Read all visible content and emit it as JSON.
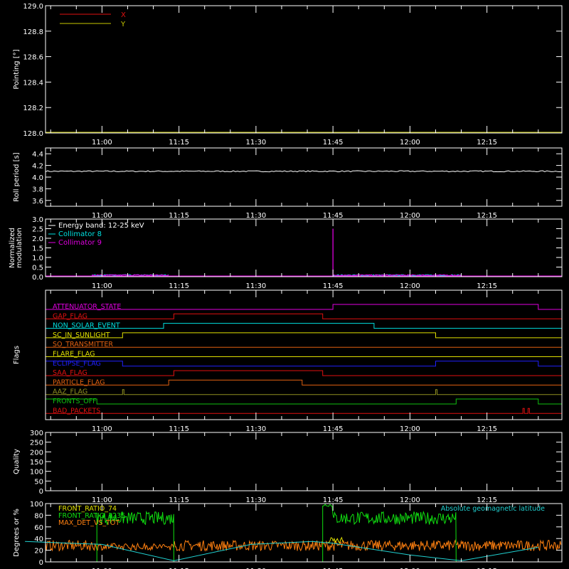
{
  "time_ticks": [
    "11:00",
    "11:15",
    "11:30",
    "11:45",
    "12:00",
    "12:15"
  ],
  "chart_data": [
    {
      "type": "line",
      "ylabel": "Pointing [°]",
      "ylim": [
        128.0,
        129.0
      ],
      "yticks": [
        "128.0",
        "128.2",
        "128.4",
        "128.6",
        "128.8",
        "129.0"
      ],
      "legend_position": "top-left",
      "series": [
        {
          "name": "X",
          "color": "#e01010",
          "values": []
        },
        {
          "name": "Y",
          "color": "#c8c800",
          "values": []
        }
      ]
    },
    {
      "type": "line",
      "ylabel": "Roll period [s]",
      "ylim": [
        3.5,
        4.5
      ],
      "yticks": [
        "3.6",
        "3.8",
        "4.0",
        "4.2",
        "4.4"
      ],
      "series": [
        {
          "color": "#ffffff",
          "x": [
            "10:45",
            "12:25"
          ],
          "values": [
            4.1,
            4.1
          ]
        }
      ]
    },
    {
      "type": "line",
      "ylabel": [
        "Normalized",
        "modulation"
      ],
      "ylim": [
        0,
        3.0
      ],
      "yticks": [
        "0.0",
        "0.5",
        "1.0",
        "1.5",
        "2.0",
        "2.5",
        "3.0"
      ],
      "legend_position": "top-left",
      "legend_title": "Energy band: 12-25 keV",
      "series": [
        {
          "name": "Collimator 8",
          "color": "#00e0e0",
          "segments": [
            [
              "10:58",
              "11:13"
            ],
            [
              "11:45",
              "12:10"
            ]
          ],
          "baseline": 0.05,
          "spike": null
        },
        {
          "name": "Collimator 9",
          "color": "#e000e0",
          "segments": [
            [
              "10:58",
              "11:13"
            ],
            [
              "11:45",
              "12:10"
            ]
          ],
          "baseline": 0.05,
          "spike": {
            "x": "11:45",
            "value": 2.5
          }
        }
      ]
    },
    {
      "type": "step",
      "ylabel": "Flags",
      "flags": [
        {
          "name": "ATTENUATOR_STATE",
          "color": "#e000e0",
          "on": [
            [
              "11:45",
              "12:25"
            ]
          ]
        },
        {
          "name": "GAP_FLAG",
          "color": "#e01010",
          "on": [
            [
              "11:14",
              "11:43"
            ]
          ]
        },
        {
          "name": "NON_SOLAR_EVENT",
          "color": "#00e0e0",
          "on": [
            [
              "11:12",
              "11:53"
            ]
          ]
        },
        {
          "name": "SC_IN_SUNLIGHT",
          "color": "#e0e000",
          "on": [
            [
              "11:04",
              "12:05"
            ]
          ]
        },
        {
          "name": "SO_TRANSMITTER",
          "color": "#e06010",
          "on": []
        },
        {
          "name": "FLARE_FLAG",
          "color": "#e0e000",
          "on": []
        },
        {
          "name": "ECLIPSE_FLAG",
          "color": "#2020ff",
          "on": [
            [
              "10:45",
              "11:04"
            ],
            [
              "12:05",
              "12:25"
            ]
          ]
        },
        {
          "name": "SAA_FLAG",
          "color": "#e01010",
          "on": [
            [
              "11:14",
              "11:43"
            ]
          ]
        },
        {
          "name": "PARTICLE_FLAG",
          "color": "#e06010",
          "on": [
            [
              "11:13",
              "11:39"
            ]
          ]
        },
        {
          "name": "AAZ_FLAG",
          "color": "#909020",
          "on": [
            [
              "11:04",
              "11:04"
            ],
            [
              "12:05",
              "12:05"
            ]
          ]
        },
        {
          "name": "FRONTS_OFF",
          "color": "#10c010",
          "on": [
            [
              "10:45",
              "10:59"
            ],
            [
              "12:09",
              "12:25"
            ]
          ]
        },
        {
          "name": "BAD_PACKETS",
          "color": "#e01010",
          "on": [
            [
              "12:22",
              "12:22"
            ],
            [
              "12:23",
              "12:23"
            ]
          ]
        }
      ]
    },
    {
      "type": "line",
      "ylabel": "Quality",
      "ylim": [
        0,
        300
      ],
      "yticks": [
        "0",
        "50",
        "100",
        "150",
        "200",
        "250",
        "300"
      ],
      "series": [
        {
          "color": "#ffffff",
          "x": [
            "10:45",
            "12:25"
          ],
          "values": [
            300,
            300
          ]
        }
      ]
    },
    {
      "type": "line",
      "ylabel": "Degrees or %",
      "ylim": [
        0,
        100
      ],
      "yticks": [
        "0",
        "20",
        "40",
        "60",
        "80",
        "100"
      ],
      "legend_position": "top-left",
      "series": [
        {
          "name": "FRONT_RATIO_74",
          "color": "#e0e000"
        },
        {
          "name": "FRONT_RATIO_1235",
          "color": "#10e010",
          "segments": [
            [
              "10:59",
              "11:14"
            ],
            [
              "11:43",
              "12:09"
            ]
          ],
          "level": 75
        },
        {
          "name": "MAX_DET_VS_TOT",
          "color": "#ff8010",
          "level": 25
        },
        {
          "name": "Absolute geomagnetic latitude",
          "color": "#20d0d0",
          "x": [
            "10:45",
            "11:00",
            "11:14",
            "11:29",
            "11:41",
            "11:45",
            "12:00",
            "12:10",
            "12:25"
          ],
          "values": [
            35,
            30,
            2,
            30,
            35,
            32,
            12,
            2,
            25
          ]
        }
      ]
    }
  ]
}
